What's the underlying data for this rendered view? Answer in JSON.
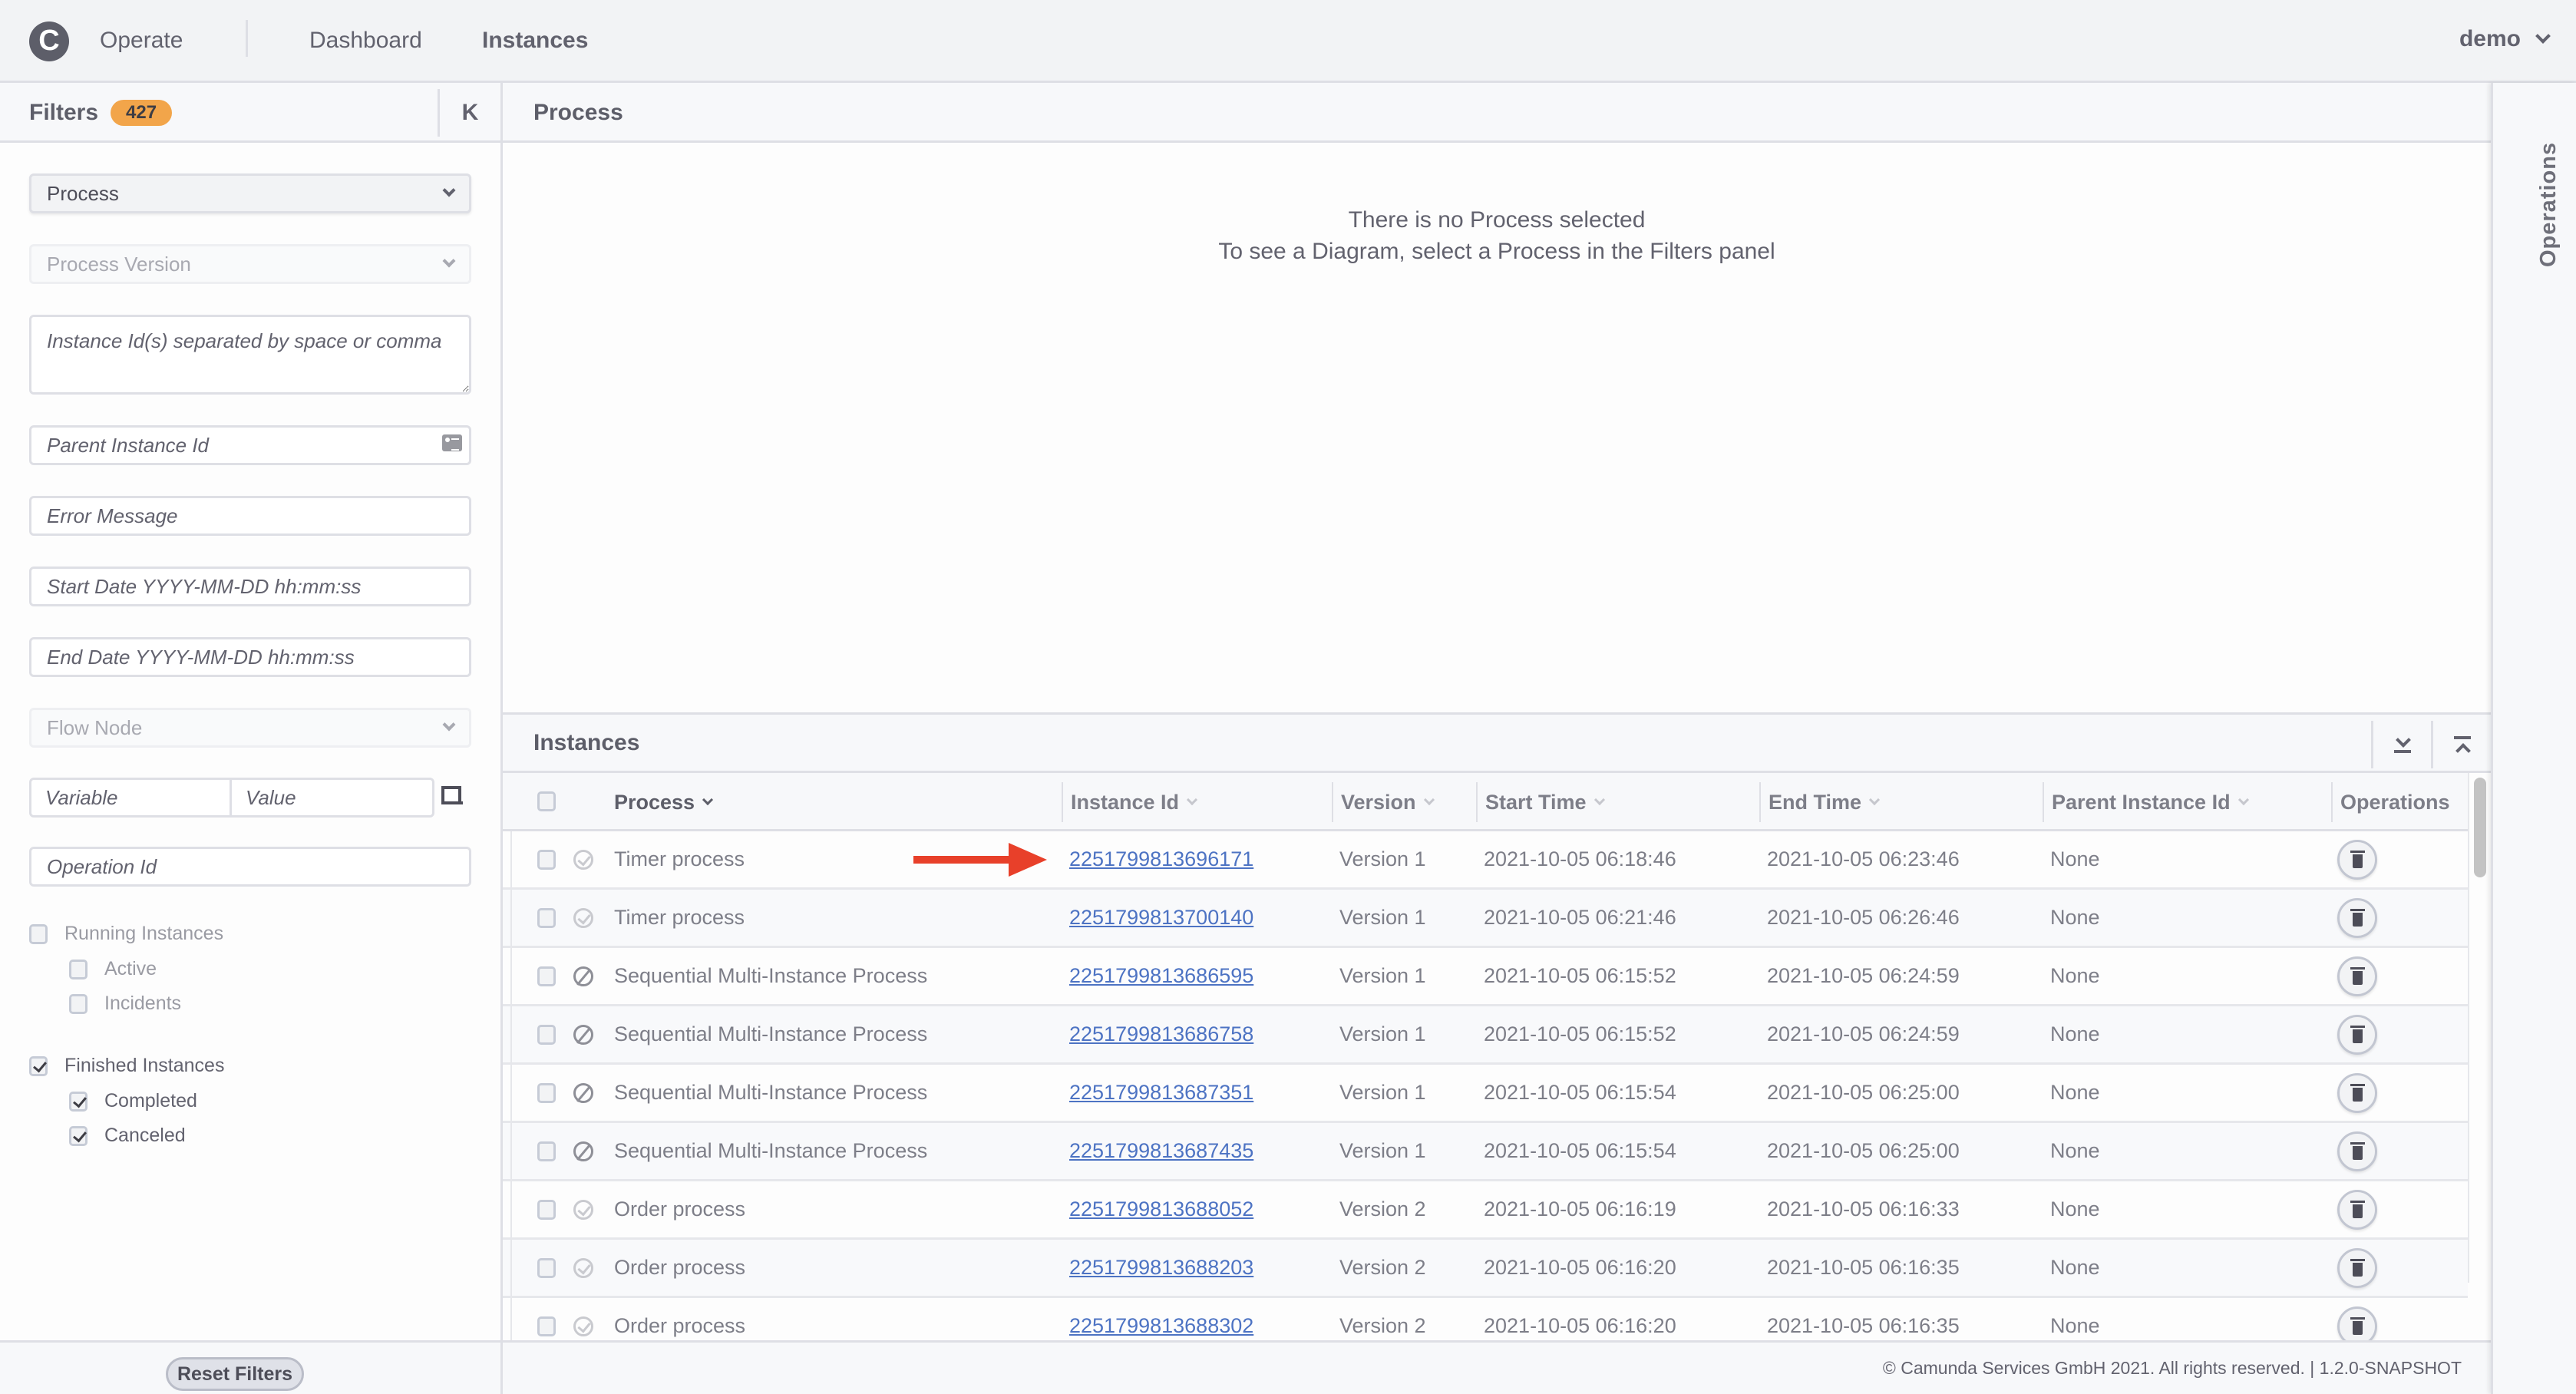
{
  "header": {
    "logo_letter": "C",
    "app_name": "Operate",
    "nav": [
      {
        "label": "Dashboard",
        "active": false
      },
      {
        "label": "Instances",
        "active": true
      }
    ],
    "user": "demo"
  },
  "filters": {
    "title": "Filters",
    "count": "427",
    "collapse_icon": "K",
    "process_select": "Process",
    "process_version_select": "Process Version",
    "instance_ids_placeholder": "Instance Id(s) separated by space or comma",
    "parent_instance_placeholder": "Parent Instance Id",
    "error_message_placeholder": "Error Message",
    "start_date_placeholder": "Start Date YYYY-MM-DD hh:mm:ss",
    "end_date_placeholder": "End Date YYYY-MM-DD hh:mm:ss",
    "flow_node_select": "Flow Node",
    "variable_placeholder": "Variable",
    "value_placeholder": "Value",
    "operation_id_placeholder": "Operation Id",
    "checkboxes": {
      "running": {
        "label": "Running Instances",
        "checked": false
      },
      "active": {
        "label": "Active",
        "checked": false
      },
      "incidents": {
        "label": "Incidents",
        "checked": false
      },
      "finished": {
        "label": "Finished Instances",
        "checked": true
      },
      "completed": {
        "label": "Completed",
        "checked": true
      },
      "canceled": {
        "label": "Canceled",
        "checked": true
      }
    },
    "reset_label": "Reset Filters"
  },
  "process_panel": {
    "title": "Process",
    "empty_line1": "There is no Process selected",
    "empty_line2": "To see a Diagram, select a Process in the Filters panel"
  },
  "instances": {
    "title": "Instances",
    "columns": {
      "process": "Process",
      "instance_id": "Instance Id",
      "version": "Version",
      "start_time": "Start Time",
      "end_time": "End Time",
      "parent_instance_id": "Parent Instance Id",
      "operations": "Operations"
    },
    "rows": [
      {
        "state": "completed",
        "process": "Timer process",
        "id": "2251799813696171",
        "version": "Version 1",
        "start": "2021-10-05 06:18:46",
        "end": "2021-10-05 06:23:46",
        "parent": "None"
      },
      {
        "state": "completed",
        "process": "Timer process",
        "id": "2251799813700140",
        "version": "Version 1",
        "start": "2021-10-05 06:21:46",
        "end": "2021-10-05 06:26:46",
        "parent": "None"
      },
      {
        "state": "canceled",
        "process": "Sequential Multi-Instance Process",
        "id": "2251799813686595",
        "version": "Version 1",
        "start": "2021-10-05 06:15:52",
        "end": "2021-10-05 06:24:59",
        "parent": "None"
      },
      {
        "state": "canceled",
        "process": "Sequential Multi-Instance Process",
        "id": "2251799813686758",
        "version": "Version 1",
        "start": "2021-10-05 06:15:52",
        "end": "2021-10-05 06:24:59",
        "parent": "None"
      },
      {
        "state": "canceled",
        "process": "Sequential Multi-Instance Process",
        "id": "2251799813687351",
        "version": "Version 1",
        "start": "2021-10-05 06:15:54",
        "end": "2021-10-05 06:25:00",
        "parent": "None"
      },
      {
        "state": "canceled",
        "process": "Sequential Multi-Instance Process",
        "id": "2251799813687435",
        "version": "Version 1",
        "start": "2021-10-05 06:15:54",
        "end": "2021-10-05 06:25:00",
        "parent": "None"
      },
      {
        "state": "completed",
        "process": "Order process",
        "id": "2251799813688052",
        "version": "Version 2",
        "start": "2021-10-05 06:16:19",
        "end": "2021-10-05 06:16:33",
        "parent": "None"
      },
      {
        "state": "completed",
        "process": "Order process",
        "id": "2251799813688203",
        "version": "Version 2",
        "start": "2021-10-05 06:16:20",
        "end": "2021-10-05 06:16:35",
        "parent": "None"
      },
      {
        "state": "completed",
        "process": "Order process",
        "id": "2251799813688302",
        "version": "Version 2",
        "start": "2021-10-05 06:16:20",
        "end": "2021-10-05 06:16:35",
        "parent": "None"
      }
    ]
  },
  "footer": {
    "copyright": "© Camunda Services GmbH 2021. All rights reserved. | 1.2.0-SNAPSHOT"
  },
  "operations_sidebar": {
    "label": "Operations"
  },
  "colors": {
    "badge": "#f2a54a",
    "link": "#4d73c3",
    "annotation_arrow": "#e8402a"
  }
}
